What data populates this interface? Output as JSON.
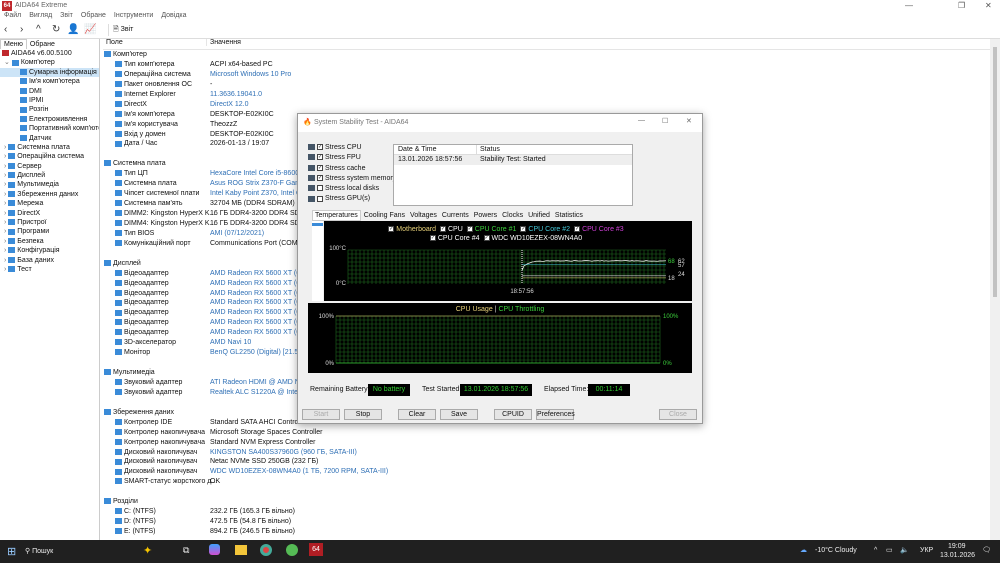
{
  "app": {
    "title": "AIDA64 Extreme",
    "logo": "64"
  },
  "menu": [
    "Файл",
    "Вигляд",
    "Звіт",
    "Обране",
    "Інструменти",
    "Довідка"
  ],
  "toolbar": {
    "report_label": "Звіт"
  },
  "left": {
    "tabs": [
      "Меню",
      "Обране"
    ],
    "tree": [
      {
        "label": "AIDA64 v6.00.5100",
        "level": 0,
        "exp": ""
      },
      {
        "label": "Комп'ютер",
        "level": 1,
        "exp": "v"
      },
      {
        "label": "Сумарна інформація",
        "level": 2,
        "exp": "",
        "sel": true
      },
      {
        "label": "Ім'я комп'ютера",
        "level": 2,
        "exp": ""
      },
      {
        "label": "DMI",
        "level": 2,
        "exp": ""
      },
      {
        "label": "IPMI",
        "level": 2,
        "exp": ""
      },
      {
        "label": "Розгін",
        "level": 2,
        "exp": ""
      },
      {
        "label": "Електроживлення",
        "level": 2,
        "exp": ""
      },
      {
        "label": "Портативний комп'ютер",
        "level": 2,
        "exp": ""
      },
      {
        "label": "Датчик",
        "level": 2,
        "exp": ""
      },
      {
        "label": "Системна плата",
        "level": 1,
        "exp": ">"
      },
      {
        "label": "Операційна система",
        "level": 1,
        "exp": ">"
      },
      {
        "label": "Сервер",
        "level": 1,
        "exp": ">"
      },
      {
        "label": "Дисплей",
        "level": 1,
        "exp": ">"
      },
      {
        "label": "Мультимедіа",
        "level": 1,
        "exp": ">"
      },
      {
        "label": "Збереження даних",
        "level": 1,
        "exp": ">"
      },
      {
        "label": "Мережа",
        "level": 1,
        "exp": ">"
      },
      {
        "label": "DirectX",
        "level": 1,
        "exp": ">"
      },
      {
        "label": "Пристрої",
        "level": 1,
        "exp": ">"
      },
      {
        "label": "Програми",
        "level": 1,
        "exp": ">"
      },
      {
        "label": "Безпека",
        "level": 1,
        "exp": ">"
      },
      {
        "label": "Конфігурація",
        "level": 1,
        "exp": ">"
      },
      {
        "label": "База даних",
        "level": 1,
        "exp": ">"
      },
      {
        "label": "Тест",
        "level": 1,
        "exp": ">"
      }
    ]
  },
  "list": {
    "col_field": "Поле",
    "col_value": "Значення",
    "rows": [
      {
        "t": "h",
        "f": "Комп'ютер"
      },
      {
        "t": "i",
        "f": "Тип комп'ютера",
        "v": "ACPI x64-based PC"
      },
      {
        "t": "i",
        "f": "Операційна система",
        "v": "Microsoft Windows 10 Pro",
        "link": true
      },
      {
        "t": "i",
        "f": "Пакет оновлення ОС",
        "v": "-"
      },
      {
        "t": "i",
        "f": "Internet Explorer",
        "v": "11.3636.19041.0",
        "link": true
      },
      {
        "t": "i",
        "f": "DirectX",
        "v": "DirectX 12.0",
        "link": true
      },
      {
        "t": "i",
        "f": "Ім'я комп'ютера",
        "v": "DESKTOP-E02KI0C"
      },
      {
        "t": "i",
        "f": "Ім'я користувача",
        "v": "TheozzZ"
      },
      {
        "t": "i",
        "f": "Вхід у домен",
        "v": "DESKTOP-E02KI0C"
      },
      {
        "t": "i",
        "f": "Дата / Час",
        "v": "2026-01-13 / 19:07"
      },
      {
        "t": "b"
      },
      {
        "t": "h",
        "f": "Системна плата"
      },
      {
        "t": "i",
        "f": "Тип ЦП",
        "v": "HexaCore Intel Core i5-8600K, 3600 MHz",
        "link": true
      },
      {
        "t": "i",
        "f": "Системна плата",
        "v": "Asus ROG Strix Z370-F Gaming",
        "link": true
      },
      {
        "t": "i",
        "f": "Чіпсет системної плати",
        "v": "Intel Kaby Point Z370, Intel Coffee Lake-S",
        "link": true
      },
      {
        "t": "i",
        "f": "Системна пам'ять",
        "v": "32704 МБ  (DDR4 SDRAM)"
      },
      {
        "t": "i",
        "f": "DIMM2: Kingston HyperX K...",
        "v": "16 ГБ DDR4-3200 DDR4 SDRAM"
      },
      {
        "t": "i",
        "f": "DIMM4: Kingston HyperX K...",
        "v": "16 ГБ DDR4-3200 DDR4 SDRAM"
      },
      {
        "t": "i",
        "f": "Тип BIOS",
        "v": "AMI (07/12/2021)",
        "link": true
      },
      {
        "t": "i",
        "f": "Комунікаційний порт",
        "v": "Communications Port (COM1)"
      },
      {
        "t": "b"
      },
      {
        "t": "h",
        "f": "Дисплей"
      },
      {
        "t": "i",
        "f": "Відеоадаптер",
        "v": "AMD Radeon RX 5600 XT  (6128 МБ)",
        "link": true
      },
      {
        "t": "i",
        "f": "Відеоадаптер",
        "v": "AMD Radeon RX 5600 XT  (6128 МБ)",
        "link": true
      },
      {
        "t": "i",
        "f": "Відеоадаптер",
        "v": "AMD Radeon RX 5600 XT  (6128 МБ)",
        "link": true
      },
      {
        "t": "i",
        "f": "Відеоадаптер",
        "v": "AMD Radeon RX 5600 XT  (6128 МБ)",
        "link": true
      },
      {
        "t": "i",
        "f": "Відеоадаптер",
        "v": "AMD Radeon RX 5600 XT  (6128 МБ)",
        "link": true
      },
      {
        "t": "i",
        "f": "Відеоадаптер",
        "v": "AMD Radeon RX 5600 XT  (6128 МБ)",
        "link": true
      },
      {
        "t": "i",
        "f": "Відеоадаптер",
        "v": "AMD Radeon RX 5600 XT  (6128 МБ)",
        "link": true
      },
      {
        "t": "i",
        "f": "3D-акселератор",
        "v": "AMD Navi 10",
        "link": true
      },
      {
        "t": "i",
        "f": "Монітор",
        "v": "BenQ GL2250 (Digital)  [21.5\" LCD]",
        "link": true
      },
      {
        "t": "b"
      },
      {
        "t": "h",
        "f": "Мультимедіа"
      },
      {
        "t": "i",
        "f": "Звуковий адаптер",
        "v": "ATI Radeon HDMI @ AMD Navi 10",
        "link": true
      },
      {
        "t": "i",
        "f": "Звуковий адаптер",
        "v": "Realtek ALC S1220A @ Intel Kaby Point",
        "link": true
      },
      {
        "t": "b"
      },
      {
        "t": "h",
        "f": "Збереження даних"
      },
      {
        "t": "i",
        "f": "Контролер IDE",
        "v": "Standard SATA AHCI Controller"
      },
      {
        "t": "i",
        "f": "Контролер накопичувача",
        "v": "Microsoft Storage Spaces Controller"
      },
      {
        "t": "i",
        "f": "Контролер накопичувача",
        "v": "Standard NVM Express Controller"
      },
      {
        "t": "i",
        "f": "Дисковий накопичувач",
        "v": "KINGSTON SA400S37960G  (960 ГБ, SATA-III)",
        "link": true
      },
      {
        "t": "i",
        "f": "Дисковий накопичувач",
        "v": "Netac NVMe SSD 250GB  (232 ГБ)"
      },
      {
        "t": "i",
        "f": "Дисковий накопичувач",
        "v": "WDC WD10EZEX-08WN4A0  (1 ТБ, 7200 RPM, SATA-III)",
        "link": true
      },
      {
        "t": "i",
        "f": "SMART-статус жорсткого д...",
        "v": "OK"
      },
      {
        "t": "b"
      },
      {
        "t": "h",
        "f": "Розділи"
      },
      {
        "t": "i",
        "f": "C: (NTFS)",
        "v": "232.2 ГБ (165.3 ГБ вільно)"
      },
      {
        "t": "i",
        "f": "D: (NTFS)",
        "v": "472.5 ГБ (54.8 ГБ вільно)"
      },
      {
        "t": "i",
        "f": "E: (NTFS)",
        "v": "894.2 ГБ (246.5 ГБ вільно)"
      }
    ]
  },
  "dialog": {
    "title": "System Stability Test - AIDA64",
    "stress": [
      {
        "label": "Stress CPU",
        "on": true
      },
      {
        "label": "Stress FPU",
        "on": true
      },
      {
        "label": "Stress cache",
        "on": true
      },
      {
        "label": "Stress system memory",
        "on": true
      },
      {
        "label": "Stress local disks",
        "on": false
      },
      {
        "label": "Stress GPU(s)",
        "on": false
      }
    ],
    "log": {
      "col_date": "Date & Time",
      "col_status": "Status",
      "rows": [
        {
          "date": "13.01.2026 18:57:56",
          "status": "Stability Test: Started"
        }
      ]
    },
    "tabs": [
      "Temperatures",
      "Cooling Fans",
      "Voltages",
      "Currents",
      "Powers",
      "Clocks",
      "Unified",
      "Statistics"
    ],
    "legend": [
      {
        "label": "Motherboard",
        "color": "#e8d27a"
      },
      {
        "label": "CPU",
        "color": "#ffffff"
      },
      {
        "label": "CPU Core #1",
        "color": "#3ccf3c"
      },
      {
        "label": "CPU Core #2",
        "color": "#44c8d8"
      },
      {
        "label": "CPU Core #3",
        "color": "#d040d8"
      },
      {
        "label": "CPU Core #4",
        "color": "#ffffff"
      },
      {
        "label": "WDC WD10EZEX-08WN4A0",
        "color": "#ffffff"
      }
    ],
    "temp": {
      "ymax": "100°C",
      "ymin": "0°C",
      "xlabel": "18:57:56",
      "right": [
        "68",
        "62",
        "57",
        "18",
        "24"
      ]
    },
    "usage": {
      "title1": "CPU Usage",
      "sep": "|",
      "title2": "CPU Throttling",
      "l_top": "100%",
      "l_bot": "0%",
      "r_top": "100%",
      "r_bot": "0%"
    },
    "battery_label": "Remaining Battery:",
    "battery": "No battery",
    "started_label": "Test Started:",
    "started": "13.01.2026 18:57:56",
    "elapsed_label": "Elapsed Time:",
    "elapsed": "00:11:14",
    "buttons": {
      "start": "Start",
      "stop": "Stop",
      "clear": "Clear",
      "save": "Save",
      "cpuid": "CPUID",
      "prefs": "Preferences",
      "close": "Close"
    }
  },
  "taskbar": {
    "search": "Пошук",
    "app_badge": "64",
    "weather": "-10°C  Cloudy",
    "lang": "УКР",
    "time": "19:09",
    "date": "13.01.2026"
  }
}
